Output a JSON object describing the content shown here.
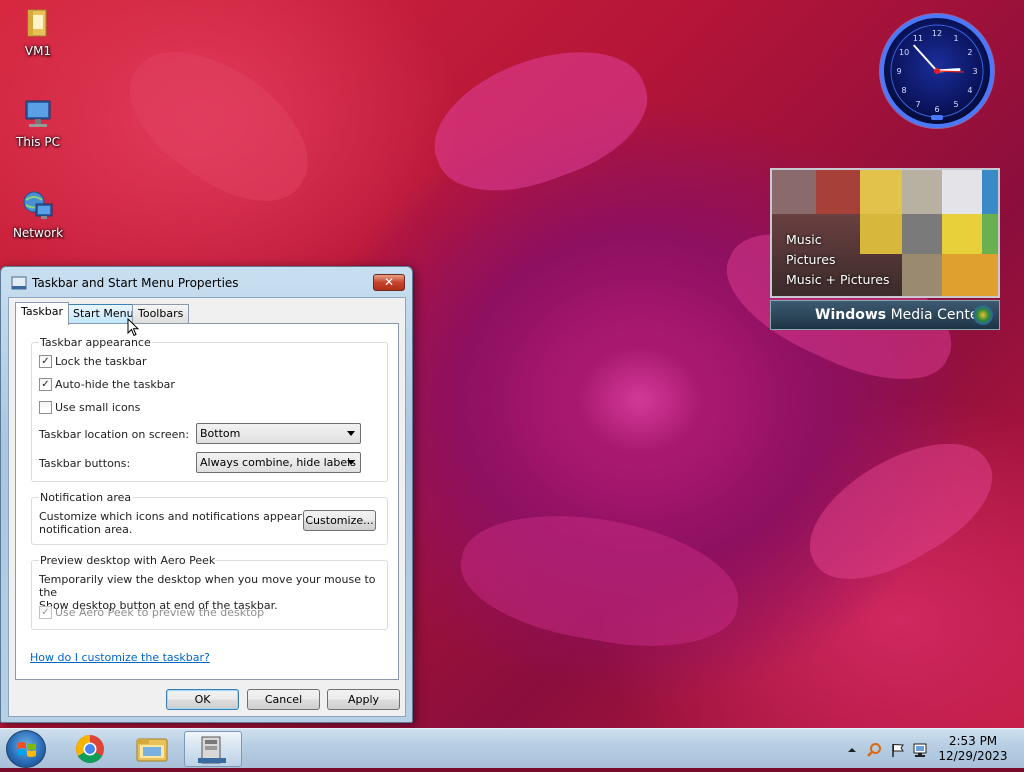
{
  "desktop": {
    "icons": [
      {
        "label": "VM1",
        "icon": "folder-icon"
      },
      {
        "label": "This PC",
        "icon": "computer-icon"
      },
      {
        "label": "Network",
        "icon": "network-icon"
      }
    ]
  },
  "gadgets": {
    "clock": {
      "hour": 2,
      "minute": 53
    },
    "media_center": {
      "menu": [
        "Music",
        "Pictures",
        "Music + Pictures"
      ],
      "brand_bold": "Windows",
      "brand_rest": " Media Center"
    }
  },
  "dialog": {
    "title": "Taskbar and Start Menu Properties",
    "close_label": "✕",
    "tabs": [
      "Taskbar",
      "Start Menu",
      "Toolbars"
    ],
    "active_tab": "Taskbar",
    "appearance": {
      "title": "Taskbar appearance",
      "checkboxes": [
        {
          "label": "Lock the taskbar",
          "checked": true
        },
        {
          "label": "Auto-hide the taskbar",
          "checked": true
        },
        {
          "label": "Use small icons",
          "checked": false
        }
      ],
      "location_label": "Taskbar location on screen:",
      "location_value": "Bottom",
      "buttons_label": "Taskbar buttons:",
      "buttons_value": "Always combine, hide labels"
    },
    "notification": {
      "title": "Notification area",
      "text_line1": "Customize which icons and notifications appear in the",
      "text_line2": "notification area.",
      "customize_label": "Customize..."
    },
    "peek": {
      "title": "Preview desktop with Aero Peek",
      "text_line1": "Temporarily view the desktop when you move your mouse to the",
      "text_line2": "Show desktop button at end of the taskbar.",
      "checkbox_label": "Use Aero Peek to preview the desktop",
      "checked": true,
      "disabled": true
    },
    "help_link": "How do I customize the taskbar?",
    "ok_label": "OK",
    "cancel_label": "Cancel",
    "apply_label": "Apply"
  },
  "taskbar": {
    "pinned": [
      "chrome-icon",
      "file-explorer-icon",
      "taskbar-properties-icon"
    ],
    "time": "2:53 PM",
    "date": "12/29/2023"
  },
  "colors": {
    "link": "#0066cc",
    "title_bar": "#b7d0e6",
    "close_button": "#c7432b",
    "taskbar": "#b6cde2"
  }
}
